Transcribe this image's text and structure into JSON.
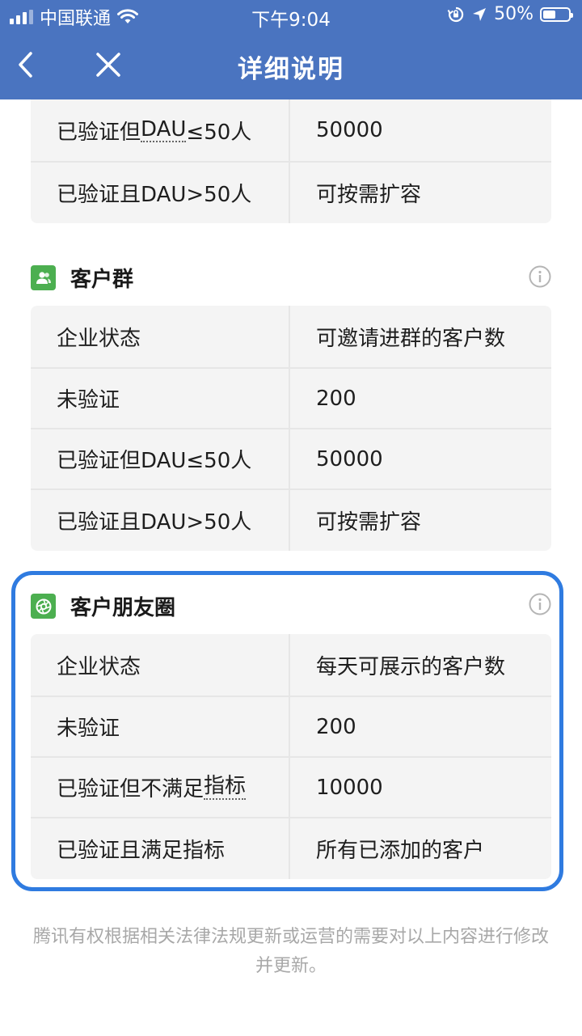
{
  "status_bar": {
    "carrier": "中国联通",
    "time": "下午9:04",
    "battery": "50%",
    "battery_level": 0.5
  },
  "nav": {
    "title": "详细说明",
    "back_icon": "chevron-left-icon",
    "close_icon": "close-icon"
  },
  "table_top": {
    "rows": [
      {
        "label_prefix": "已验证但",
        "label_term": "DAU",
        "label_suffix": "≤50人",
        "value": "50000"
      },
      {
        "label": "已验证且DAU>50人",
        "value": "可按需扩容"
      }
    ]
  },
  "customer_group": {
    "title": "客户群",
    "icon": "customers-icon",
    "info_icon": "info-icon",
    "header": {
      "col1": "企业状态",
      "col2": "可邀请进群的客户数"
    },
    "rows": [
      {
        "label": "未验证",
        "value": "200"
      },
      {
        "label": "已验证但DAU≤50人",
        "value": "50000"
      },
      {
        "label": "已验证且DAU>50人",
        "value": "可按需扩容"
      }
    ]
  },
  "moments": {
    "title": "客户朋友圈",
    "icon": "moments-aperture-icon",
    "info_icon": "info-icon",
    "header": {
      "col1": "企业状态",
      "col2": "每天可展示的客户数"
    },
    "rows": [
      {
        "label": "未验证",
        "value": "200"
      },
      {
        "label_prefix": "已验证但不满足",
        "label_term": "指标",
        "value": "10000"
      },
      {
        "label": "已验证且满足指标",
        "value": "所有已添加的客户"
      }
    ],
    "highlight_color": "#2f7be0"
  },
  "footer": {
    "note": "腾讯有权根据相关法律法规更新或运营的需要对以上内容进行修改并更新。"
  },
  "colors": {
    "header_bg": "#4a74c0",
    "table_bg": "#f4f4f4",
    "icon_green": "#4caf50"
  }
}
